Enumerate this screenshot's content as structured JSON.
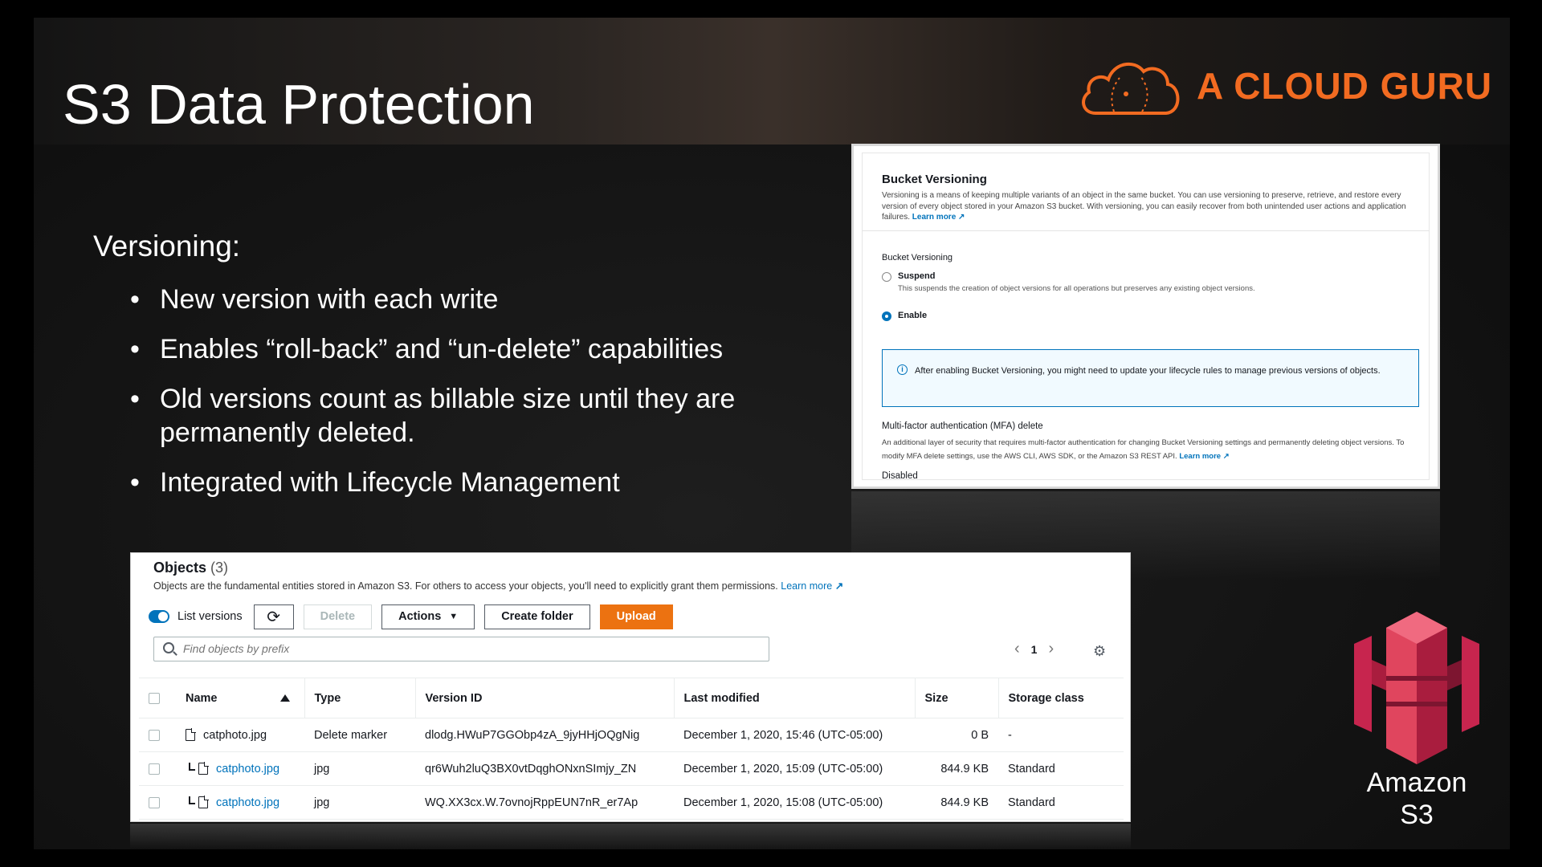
{
  "slide": {
    "title": "S3 Data Protection",
    "brand": "A CLOUD GURU",
    "section_heading": "Versioning:",
    "bullets": [
      "New version with each write",
      "Enables “roll-back” and “un-delete” capabilities",
      "Old versions count as billable size until they are permanently deleted.",
      "Integrated with Lifecycle Management"
    ],
    "s3_caption_line1": "Amazon",
    "s3_caption_line2": "S3"
  },
  "colors": {
    "brand_orange": "#f26b21",
    "aws_blue": "#0073bb",
    "upload_orange": "#ec7211",
    "s3_red": "#c7254e"
  },
  "bucket_versioning": {
    "title": "Bucket Versioning",
    "description": "Versioning is a means of keeping multiple variants of an object in the same bucket. You can use versioning to preserve, retrieve, and restore every version of every object stored in your Amazon S3 bucket. With versioning, you can easily recover from both unintended user actions and application failures.",
    "learn_more": "Learn more",
    "field_label": "Bucket Versioning",
    "options": [
      {
        "label": "Suspend",
        "description": "This suspends the creation of object versions for all operations but preserves any existing object versions.",
        "selected": false
      },
      {
        "label": "Enable",
        "description": "",
        "selected": true
      }
    ],
    "info_text": "After enabling Bucket Versioning, you might need to update your lifecycle rules to manage previous versions of objects.",
    "mfa_title": "Multi-factor authentication (MFA) delete",
    "mfa_description": "An additional layer of security that requires multi-factor authentication for changing Bucket Versioning settings and permanently deleting object versions. To modify MFA delete settings, use the AWS CLI, AWS SDK, or the Amazon S3 REST API.",
    "mfa_learn_more": "Learn more",
    "mfa_status": "Disabled"
  },
  "objects": {
    "title": "Objects",
    "count": "(3)",
    "description": "Objects are the fundamental entities stored in Amazon S3. For others to access your objects, you'll need to explicitly grant them permissions.",
    "learn_more": "Learn more",
    "toggle_label": "List versions",
    "toggle_on": true,
    "buttons": {
      "delete": "Delete",
      "actions": "Actions",
      "create_folder": "Create folder",
      "upload": "Upload"
    },
    "search_placeholder": "Find objects by prefix",
    "page": "1",
    "columns": [
      "Name",
      "Type",
      "Version ID",
      "Last modified",
      "Size",
      "Storage class"
    ],
    "rows": [
      {
        "name": "catphoto.jpg",
        "type": "Delete marker",
        "version_id": "dlodg.HWuP7GGObp4zA_9jyHHjOQgNig",
        "last_modified": "December 1, 2020, 15:46 (UTC-05:00)",
        "size": "0 B",
        "storage_class": "-"
      },
      {
        "name": "catphoto.jpg",
        "type": "jpg",
        "version_id": "qr6Wuh2luQ3BX0vtDqghONxnSImjy_ZN",
        "last_modified": "December 1, 2020, 15:09 (UTC-05:00)",
        "size": "844.9 KB",
        "storage_class": "Standard"
      },
      {
        "name": "catphoto.jpg",
        "type": "jpg",
        "version_id": "WQ.XX3cx.W.7ovnojRppEUN7nR_er7Ap",
        "last_modified": "December 1, 2020, 15:08 (UTC-05:00)",
        "size": "844.9 KB",
        "storage_class": "Standard"
      }
    ]
  }
}
